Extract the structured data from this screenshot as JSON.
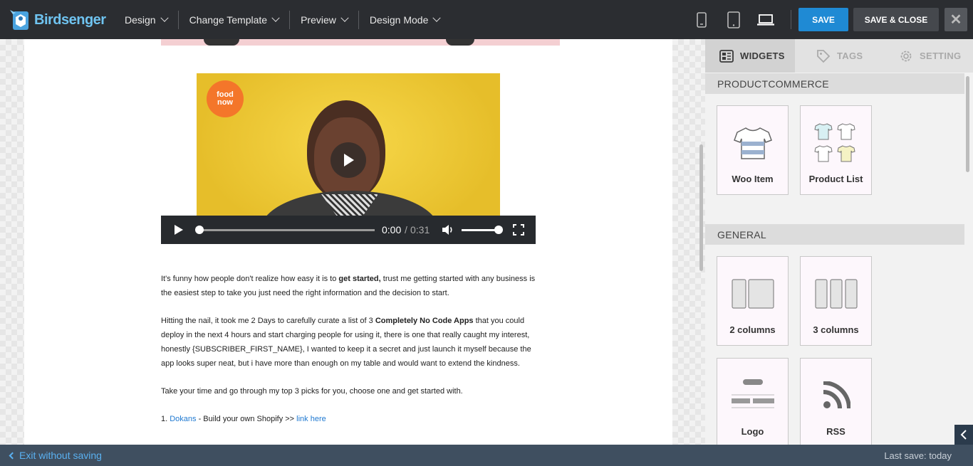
{
  "app": {
    "brand": "Birdsenger"
  },
  "menu": {
    "items": [
      {
        "label": "Design"
      },
      {
        "label": "Change Template"
      },
      {
        "label": "Preview"
      },
      {
        "label": "Design Mode"
      }
    ]
  },
  "devices": [
    "mobile-icon",
    "tablet-icon",
    "laptop-icon"
  ],
  "toolbar": {
    "save_label": "SAVE",
    "save_close_label": "SAVE & CLOSE",
    "close_symbol": "✕"
  },
  "video": {
    "logo_text_1": "food",
    "logo_text_2": "now",
    "current_time": "0:00",
    "time_separator": "/",
    "duration": "0:31",
    "progress": 0,
    "volume": 1
  },
  "content": {
    "p1_a": "It's funny how people don't realize how easy it is to ",
    "p1_bold": "get started,",
    "p1_b": " trust me getting started with any business is the easiest step to take you just need the right information and the decision to start.",
    "p2_a": "Hitting the nail, it took me 2 Days to carefully curate a list of 3 ",
    "p2_bold": "Completely No Code Apps",
    "p2_b": " that you could deploy in the next 4 hours and start charging people for using it, there is one that really caught my interest, honestly {SUBSCRIBER_FIRST_NAME}, I wanted to keep it a secret and just launch it myself because the app looks super neat, but i have more than enough on my table and would want to extend the kindness.",
    "p3": "Take your time and go through my top 3 picks for you, choose one and get started with.",
    "list1_num": "1. ",
    "list1_link": "Dokans",
    "list1_text": " - Build your own Shopify >> ",
    "list1_link2": "link here"
  },
  "panel": {
    "tabs": [
      {
        "label": "WIDGETS",
        "icon": "widgets-icon",
        "active": true
      },
      {
        "label": "TAGS",
        "icon": "tag-icon",
        "active": false
      },
      {
        "label": "SETTING",
        "icon": "gear-icon",
        "active": false
      }
    ],
    "sections": [
      {
        "title": "PRODUCTCOMMERCE",
        "widgets": [
          {
            "label": "Woo Item"
          },
          {
            "label": "Product List"
          }
        ]
      },
      {
        "title": "GENERAL",
        "widgets": [
          {
            "label": "2 columns"
          },
          {
            "label": "3 columns"
          },
          {
            "label": "Logo"
          },
          {
            "label": "RSS"
          }
        ]
      }
    ]
  },
  "footer": {
    "exit_label": "Exit without saving",
    "last_save": "Last save: today"
  },
  "colors": {
    "accent": "#1f8ad4",
    "topbar": "#2b2d31",
    "footer": "#3f4f60",
    "link": "#1f79d1"
  }
}
